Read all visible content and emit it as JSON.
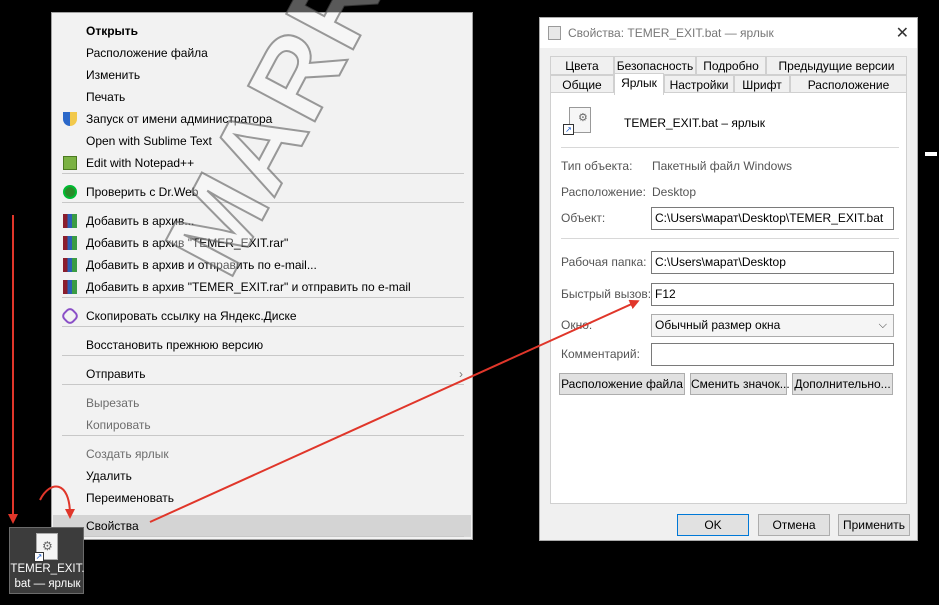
{
  "context_menu": {
    "items": [
      {
        "label": "Открыть",
        "bold": true,
        "icon": null,
        "disabled": false
      },
      {
        "label": "Расположение файла",
        "icon": null,
        "disabled": false
      },
      {
        "label": "Изменить",
        "icon": null,
        "disabled": false
      },
      {
        "label": "Печать",
        "icon": null,
        "disabled": false
      },
      {
        "label": "Запуск от имени администратора",
        "icon": "uac-shield-icon",
        "disabled": false
      },
      {
        "label": "Open with Sublime Text",
        "icon": null,
        "disabled": false
      },
      {
        "label": "Edit with Notepad++",
        "icon": "notepad-plus-plus-icon",
        "disabled": false
      },
      {
        "label": "Проверить с Dr.Web",
        "icon": "drweb-spider-icon",
        "disabled": false
      },
      {
        "label": "Добавить в архив...",
        "icon": "winrar-archive-icon",
        "disabled": false
      },
      {
        "label": "Добавить в архив \"TEMER_EXIT.rar\"",
        "icon": "winrar-archive-icon",
        "disabled": false
      },
      {
        "label": "Добавить в архив и отправить по e-mail...",
        "icon": "winrar-archive-icon",
        "disabled": false
      },
      {
        "label": "Добавить в архив \"TEMER_EXIT.rar\" и отправить по e-mail",
        "icon": "winrar-archive-icon",
        "disabled": false
      },
      {
        "label": "Скопировать ссылку на Яндекс.Диске",
        "icon": "yandex-disk-link-icon",
        "disabled": false
      },
      {
        "label": "Восстановить прежнюю версию",
        "icon": null,
        "disabled": false
      },
      {
        "label": "Отправить",
        "icon": null,
        "disabled": false,
        "submenu": true
      },
      {
        "label": "Вырезать",
        "icon": null,
        "disabled": true
      },
      {
        "label": "Копировать",
        "icon": null,
        "disabled": true
      },
      {
        "label": "Создать ярлык",
        "icon": null,
        "disabled": true
      },
      {
        "label": "Удалить",
        "icon": null,
        "disabled": false
      },
      {
        "label": "Переименовать",
        "icon": null,
        "disabled": false
      },
      {
        "label": "Свойства",
        "icon": null,
        "disabled": false,
        "highlighted": true
      }
    ],
    "submenu_arrow": "›"
  },
  "desktop_icon": {
    "label_line1": "TEMER_EXIT.",
    "label_line2": "bat — ярлык",
    "gear_glyph": "⚙",
    "shortcut_glyph": "↗"
  },
  "dialog": {
    "title": "Свойства: TEMER_EXIT.bat — ярлык",
    "close_glyph": "✕",
    "tabs_row1": [
      "Цвета",
      "Безопасность",
      "Подробно",
      "Предыдущие версии"
    ],
    "tabs_row2": [
      "Общие",
      "Ярлык",
      "Настройки",
      "Шрифт",
      "Расположение"
    ],
    "active_tab": "Ярлык",
    "shortcut_name": "TEMER_EXIT.bat – ярлык",
    "type_label": "Тип объекта:",
    "type_value": "Пакетный файл Windows",
    "location_label": "Расположение:",
    "location_value": "Desktop",
    "target_label": "Объект:",
    "target_value": "C:\\Users\\марат\\Desktop\\TEMER_EXIT.bat",
    "workdir_label": "Рабочая папка:",
    "workdir_value": "C:\\Users\\марат\\Desktop",
    "hotkey_label": "Быстрый вызов:",
    "hotkey_value": "F12",
    "window_label": "Окно:",
    "window_value": "Обычный размер окна",
    "comment_label": "Комментарий:",
    "comment_value": "",
    "chevron_glyph": "⌵",
    "btn_file_location": "Расположение файла",
    "btn_change_icon": "Сменить значок...",
    "btn_advanced": "Дополнительно...",
    "btn_ok": "OK",
    "btn_cancel": "Отмена",
    "btn_apply": "Применить"
  },
  "watermark": "MARREX.RU",
  "colors": {
    "annotation_red": "#e0362a",
    "focus_blue": "#0078d7"
  }
}
